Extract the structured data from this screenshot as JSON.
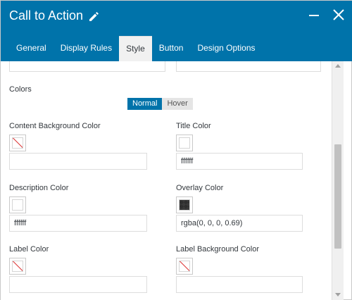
{
  "dialog": {
    "title": "Call to Action",
    "icons": {
      "edit": "pencil-icon",
      "minimize": "minimize-icon",
      "close": "close-icon"
    }
  },
  "tabs": [
    {
      "label": "General",
      "active": false
    },
    {
      "label": "Display Rules",
      "active": false
    },
    {
      "label": "Style",
      "active": true
    },
    {
      "label": "Button",
      "active": false
    },
    {
      "label": "Design Options",
      "active": false
    }
  ],
  "colors_section": {
    "heading": "Colors",
    "state_toggle": {
      "normal": "Normal",
      "hover": "Hover",
      "selected": "Normal"
    }
  },
  "fields": {
    "content_bg": {
      "label": "Content Background Color",
      "value": "",
      "swatch": "none"
    },
    "title_color": {
      "label": "Title Color",
      "value": "ffffff",
      "swatch": "#ffffff"
    },
    "description_color": {
      "label": "Description Color",
      "value": "ffffff",
      "swatch": "#ffffff"
    },
    "overlay_color": {
      "label": "Overlay Color",
      "value": "rgba(0, 0, 0, 0.69)",
      "swatch": "rgba(0,0,0,0.69)"
    },
    "label_color": {
      "label": "Label Color",
      "value": "",
      "swatch": "none"
    },
    "label_bg_color": {
      "label": "Label Background Color",
      "value": "",
      "swatch": "none"
    }
  },
  "theme": {
    "accent": "#0073aa",
    "tab_active_bg": "#f1f1f1",
    "no_color_slash": "#dc3232"
  }
}
